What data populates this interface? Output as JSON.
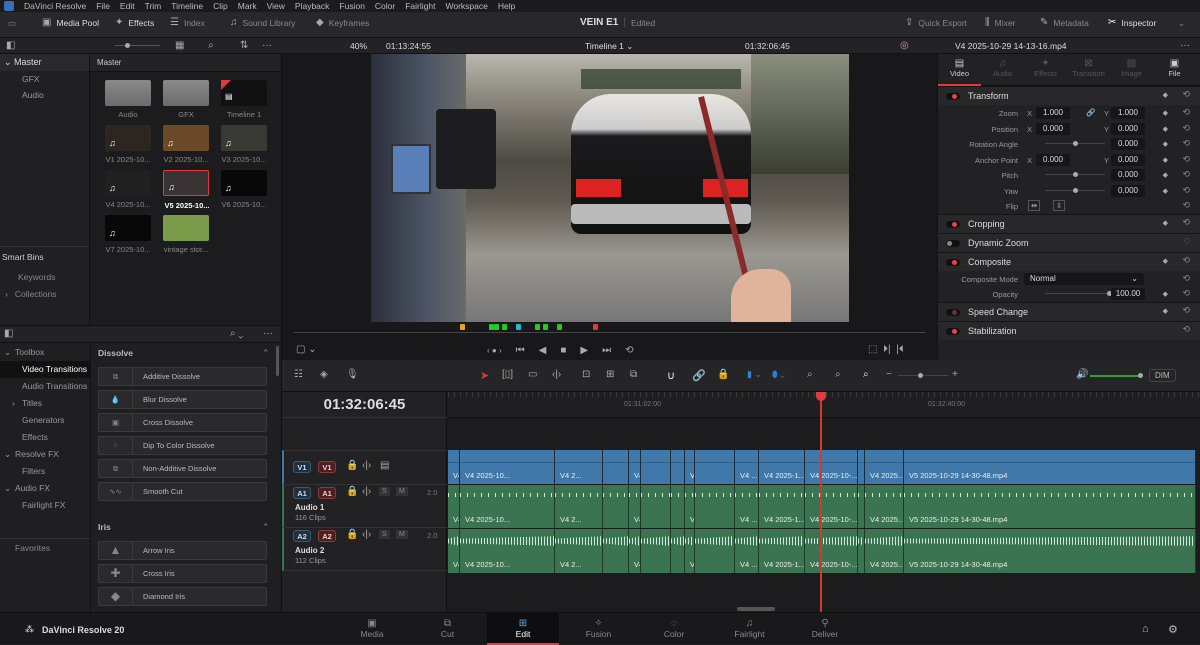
{
  "menu": {
    "app": "DaVinci Resolve",
    "items": [
      "File",
      "Edit",
      "Trim",
      "Timeline",
      "Clip",
      "Mark",
      "View",
      "Playback",
      "Fusion",
      "Color",
      "Fairlight",
      "Workspace",
      "Help"
    ]
  },
  "toolbar": {
    "media_pool": "Media Pool",
    "effects": "Effects",
    "index": "Index",
    "sound_library": "Sound Library",
    "keyframes": "Keyframes",
    "project": "VEIN E1",
    "status": "Edited",
    "quick_export": "Quick Export",
    "mixer": "Mixer",
    "metadata": "Metadata",
    "inspector": "Inspector"
  },
  "viewer": {
    "zoom": "40%",
    "source_tc": "01:13:24:55",
    "timeline_name": "Timeline 1",
    "record_tc": "01:32:06:45",
    "clip_name": "V4 2025-10-29 14-13-16.mp4"
  },
  "media_pool": {
    "root": "Master",
    "bins": [
      "GFX",
      "Audio"
    ],
    "header": "Master",
    "smart_bins": "Smart Bins",
    "smart_items": [
      "Keywords",
      "Collections"
    ],
    "clips": [
      "Audio",
      "GFX",
      "Timeline 1",
      "V1 2025-10...",
      "V2 2025-10...",
      "V3 2025-10...",
      "V4 2025-10...",
      "V5 2025-10...",
      "V6 2025-10...",
      "V7 2025-10...",
      "vintage stor..."
    ]
  },
  "inspector": {
    "tabs": [
      "Video",
      "Audio",
      "Effects",
      "Transition",
      "Image",
      "File"
    ],
    "transform": "Transform",
    "zoom_label": "Zoom",
    "zoom_x": "1.000",
    "zoom_y": "1.000",
    "position_label": "Position",
    "pos_x": "0.000",
    "pos_y": "0.000",
    "rotation_label": "Rotation Angle",
    "rotation": "0.000",
    "anchor_label": "Anchor Point",
    "anchor_x": "0.000",
    "anchor_y": "0.000",
    "pitch_label": "Pitch",
    "pitch": "0.000",
    "yaw_label": "Yaw",
    "yaw": "0.000",
    "flip_label": "Flip",
    "x": "X",
    "y": "Y",
    "cropping": "Cropping",
    "dynamic_zoom": "Dynamic Zoom",
    "composite": "Composite",
    "composite_mode_label": "Composite Mode",
    "composite_mode": "Normal",
    "opacity_label": "Opacity",
    "opacity": "100.00",
    "speed_change": "Speed Change",
    "stabilization": "Stabilization"
  },
  "effects": {
    "tree": [
      {
        "label": "Toolbox"
      },
      {
        "label": "Video Transitions"
      },
      {
        "label": "Audio Transitions"
      },
      {
        "label": "Titles"
      },
      {
        "label": "Generators"
      },
      {
        "label": "Effects"
      },
      {
        "label": "Resolve FX"
      },
      {
        "label": "Filters"
      },
      {
        "label": "Audio FX"
      },
      {
        "label": "Fairlight FX"
      }
    ],
    "favorites": "Favorites",
    "dissolve_header": "Dissolve",
    "dissolve": [
      "Additive Dissolve",
      "Blur Dissolve",
      "Cross Dissolve",
      "Dip To Color Dissolve",
      "Non-Additive Dissolve",
      "Smooth Cut"
    ],
    "iris_header": "Iris",
    "iris": [
      "Arrow Iris",
      "Cross Iris",
      "Diamond Iris"
    ]
  },
  "timeline": {
    "timecode": "01:32:06:45",
    "ruler": [
      "01:31:02:00",
      "01:32:40:00"
    ],
    "dim": "DIM",
    "tracks": {
      "v1": "V1",
      "a1": "A1",
      "a2": "A2",
      "audio1_name": "Audio 1",
      "audio1_clips": "116 Clips",
      "audio2_name": "Audio 2",
      "audio2_clips": "112 Clips",
      "a1_level": "2.0",
      "a2_level": "2.0",
      "solo": "S",
      "mute": "M"
    },
    "clips": [
      "V4 2025-10-29 14-13-16....",
      "V4 2025-10...",
      "V4 2...",
      "",
      "V4 20...",
      "",
      "",
      "V4 2025-...",
      "V4 ...",
      "V4 2025-1...",
      "V4 2025-10-...",
      "",
      "V4 2025...",
      "V5 2025-10-29 14-30-48.mp4"
    ]
  },
  "pages": [
    "Media",
    "Cut",
    "Edit",
    "Fusion",
    "Color",
    "Fairlight",
    "Deliver"
  ],
  "footer": {
    "brand": "DaVinci Resolve 20"
  },
  "colors": {
    "accent": "#e0393e",
    "video_clip": "#3f78a9",
    "audio_clip": "#3b7450"
  }
}
